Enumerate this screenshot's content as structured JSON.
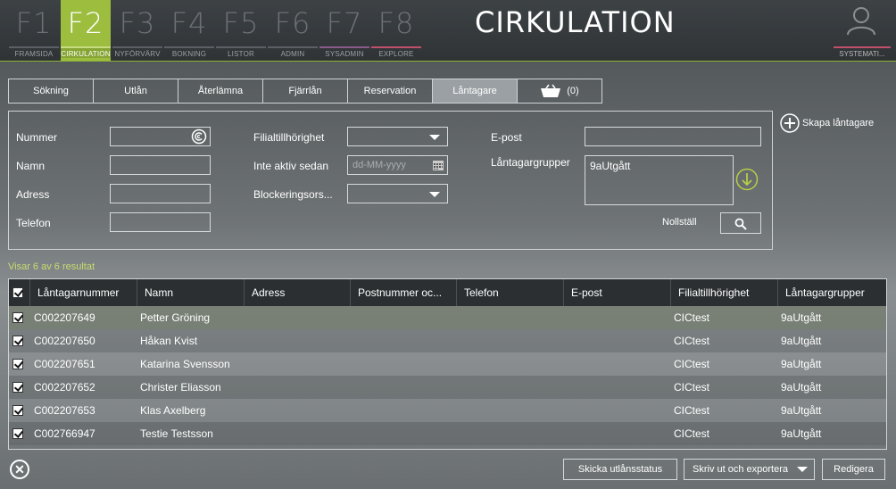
{
  "fkeys": [
    {
      "key": "F1",
      "label": "FRAMSIDA"
    },
    {
      "key": "F2",
      "label": "CIRKULATION"
    },
    {
      "key": "F3",
      "label": "NYFÖRVÄRV"
    },
    {
      "key": "F4",
      "label": "BOKNING"
    },
    {
      "key": "F5",
      "label": "LISTOR"
    },
    {
      "key": "F6",
      "label": "ADMIN"
    },
    {
      "key": "F7",
      "label": "SYSADMIN"
    },
    {
      "key": "F8",
      "label": "EXPLORE"
    }
  ],
  "app_title": "CIRKULATION",
  "user_label": "SYSTEMATI...",
  "tabs": [
    {
      "label": "Sökning"
    },
    {
      "label": "Utlån"
    },
    {
      "label": "Återlämna"
    },
    {
      "label": "Fjärrlån"
    },
    {
      "label": "Reservation"
    },
    {
      "label": "Låntagare"
    },
    {
      "label": "(0)"
    }
  ],
  "create_borrower_label": "Skapa låntagare",
  "form": {
    "number_label": "Nummer",
    "name_label": "Namn",
    "address_label": "Adress",
    "phone_label": "Telefon",
    "branch_label": "Filialtillhörighet",
    "inactive_since_label": "Inte aktiv sedan",
    "inactive_since_placeholder": "dd-MM-yyyy",
    "blocking_label": "Blockeringsors...",
    "email_label": "E-post",
    "groups_label": "Låntagargrupper",
    "groups_value": "9aUtgått",
    "reset_label": "Nollställ"
  },
  "results_count": "Visar 6 av 6 resultat",
  "table": {
    "headers": [
      "Låntagarnummer",
      "Namn",
      "Adress",
      "Postnummer oc...",
      "Telefon",
      "E-post",
      "Filialtillhörighet",
      "Låntagargrupper"
    ],
    "rows": [
      {
        "number": "C002207649",
        "name": "Petter Gröning",
        "branch": "CICtest",
        "group": "9aUtgått"
      },
      {
        "number": "C002207650",
        "name": "Håkan Kvist",
        "branch": "CICtest",
        "group": "9aUtgått"
      },
      {
        "number": "C002207651",
        "name": "Katarina Svensson",
        "branch": "CICtest",
        "group": "9aUtgått"
      },
      {
        "number": "C002207652",
        "name": "Christer Eliasson",
        "branch": "CICtest",
        "group": "9aUtgått"
      },
      {
        "number": "C002207653",
        "name": "Klas Axelberg",
        "branch": "CICtest",
        "group": "9aUtgått"
      },
      {
        "number": "C002766947",
        "name": "Testie Testsson",
        "branch": "CICtest",
        "group": "9aUtgått"
      }
    ]
  },
  "footer": {
    "send_status_label": "Skicka utlånsstatus",
    "print_export_label": "Skriv ut och exportera",
    "edit_label": "Redigera"
  },
  "colors": {
    "accent": "#9cbd3e",
    "results_text": "#c8dc6e"
  }
}
